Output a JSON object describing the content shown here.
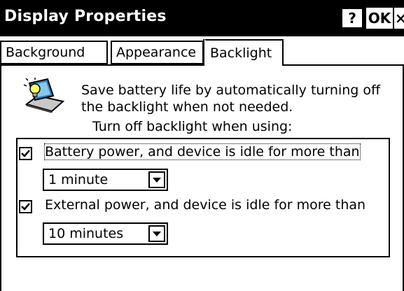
{
  "window": {
    "title": "Display Properties",
    "help_label": "?",
    "ok_label": "OK",
    "close_label": "×"
  },
  "tabs": [
    {
      "label": "Background",
      "active": false
    },
    {
      "label": "Appearance",
      "active": false
    },
    {
      "label": "Backlight",
      "active": true
    }
  ],
  "backlight": {
    "icon": "laptop-lightbulb-icon",
    "description_line1": "Save battery life by automatically turning off",
    "description_line2": "the backlight when not needed.",
    "subheading": "Turn off backlight when using:",
    "battery": {
      "checked": true,
      "label": "Battery power, and device is idle for more than",
      "selected": "1 minute"
    },
    "external": {
      "checked": true,
      "label": "External power, and device is idle for more than",
      "selected": "10 minutes"
    }
  },
  "colors": {
    "titlebar": "#000000",
    "background": "#ffffff"
  }
}
